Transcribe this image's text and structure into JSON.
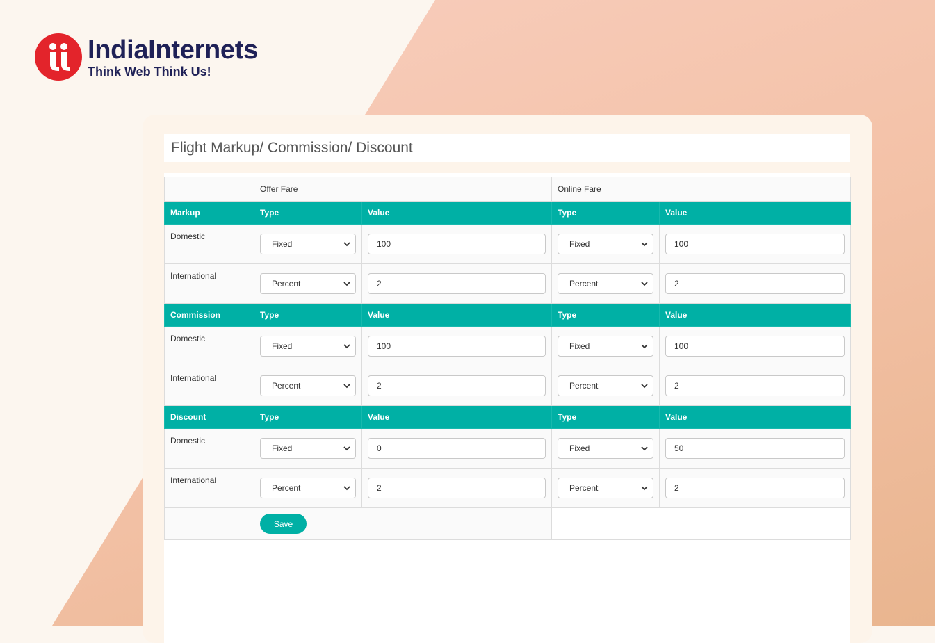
{
  "brand": {
    "name": "IndiaInternets",
    "tagline": "Think Web Think Us!",
    "logo_icon": "ii-logo-icon",
    "color": "#e3242b"
  },
  "page_title": "Flight Markup/ Commission/ Discount",
  "columns": {
    "offer_fare": "Offer Fare",
    "online_fare": "Online Fare",
    "type": "Type",
    "value": "Value"
  },
  "accent_color": "#00b0a5",
  "sections": [
    {
      "label": "Markup",
      "rows": [
        {
          "label": "Domestic",
          "offer_type": "Fixed",
          "offer_value": "100",
          "online_type": "Fixed",
          "online_value": "100"
        },
        {
          "label": "International",
          "offer_type": "Percent",
          "offer_value": "2",
          "online_type": "Percent",
          "online_value": "2"
        }
      ]
    },
    {
      "label": "Commission",
      "rows": [
        {
          "label": "Domestic",
          "offer_type": "Fixed",
          "offer_value": "100",
          "online_type": "Fixed",
          "online_value": "100"
        },
        {
          "label": "International",
          "offer_type": "Percent",
          "offer_value": "2",
          "online_type": "Percent",
          "online_value": "2"
        }
      ]
    },
    {
      "label": "Discount",
      "rows": [
        {
          "label": "Domestic",
          "offer_type": "Fixed",
          "offer_value": "0",
          "online_type": "Fixed",
          "online_value": "50"
        },
        {
          "label": "International",
          "offer_type": "Percent",
          "offer_value": "2",
          "online_type": "Percent",
          "online_value": "2"
        }
      ]
    }
  ],
  "save_label": "Save"
}
